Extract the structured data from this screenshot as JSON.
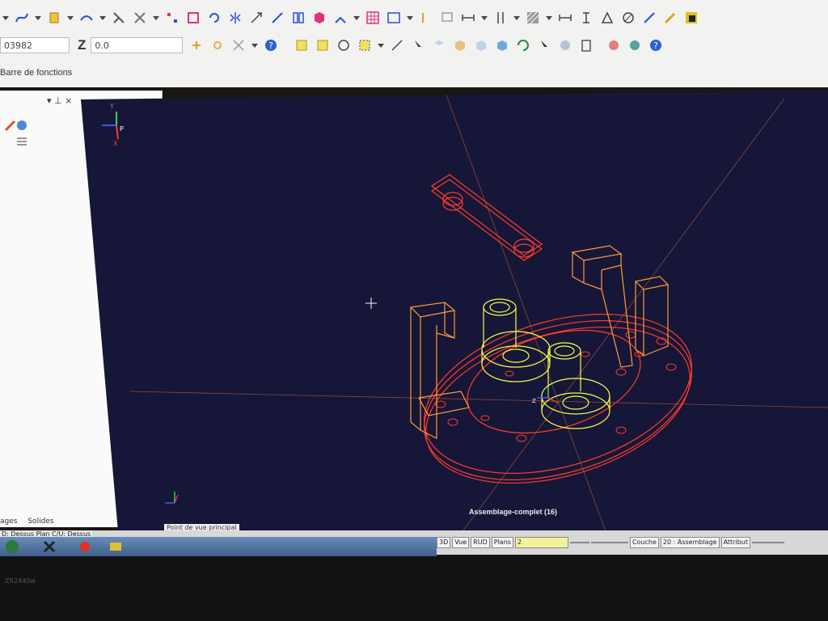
{
  "toolbar": {
    "coord_x_value": "03982",
    "coord_z_label": "Z",
    "coord_z_value": "0.0",
    "function_bar_label": "Barre de fonctions"
  },
  "left_panel": {
    "controls": "▾ ⊥ ×",
    "tab_left": "ages",
    "tab_right": "Solides"
  },
  "viewport": {
    "title": "Assemblage-complet (16)",
    "view_tab": "Point de vue principal",
    "axis_labels": {
      "x": "X",
      "y": "Y",
      "z": "Z",
      "p": "P"
    }
  },
  "statusbar": {
    "left_text": "D: Dessus  Plan C/U: Dessus",
    "btn_3d": "3D",
    "btn_vue": "Vue",
    "btn_rud": "RUD",
    "btn_plans": "Plans",
    "plans_value": "2",
    "couche_label": "Couche",
    "couche_value": "20 : Assemblage",
    "attribut_label": "Attribut"
  },
  "monitor": {
    "label": "ZR2440w"
  },
  "colors": {
    "viewport_bg": "#161638",
    "wire_red": "#ff3d2a",
    "wire_orange": "#ff9a3a",
    "wire_yellow": "#f4ff4a"
  }
}
